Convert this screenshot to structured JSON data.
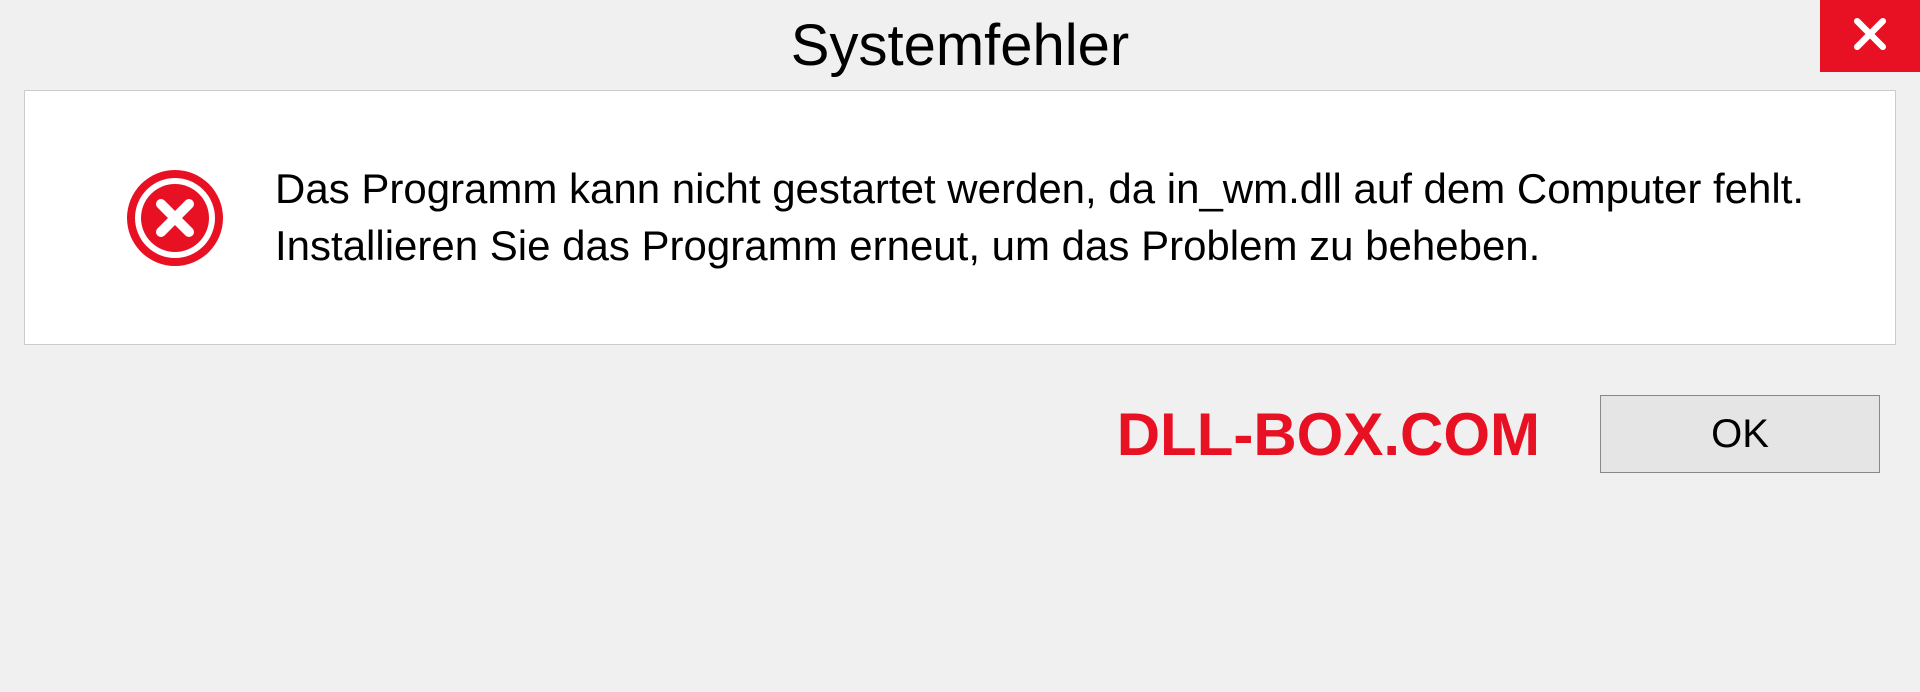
{
  "dialog": {
    "title": "Systemfehler",
    "message": "Das Programm kann nicht gestartet werden, da in_wm.dll auf dem Computer fehlt. Installieren Sie das Programm erneut, um das Problem zu beheben.",
    "ok_label": "OK"
  },
  "watermark": "DLL-BOX.COM"
}
